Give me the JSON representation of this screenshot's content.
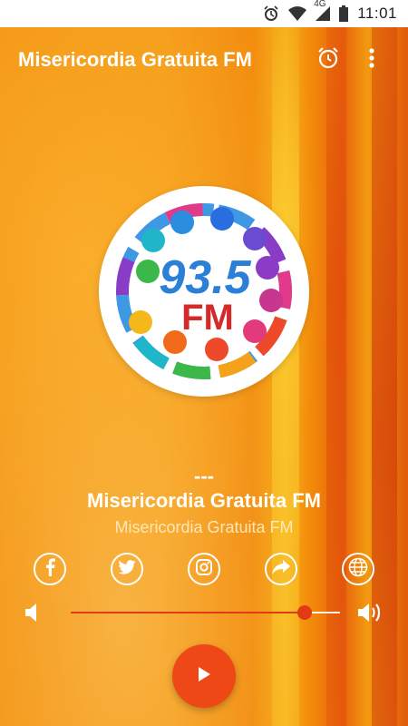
{
  "status_bar": {
    "time": "11:01",
    "network": "4G",
    "icons": [
      "alarm-icon",
      "wifi-icon",
      "signal-icon",
      "battery-icon"
    ]
  },
  "app_bar": {
    "title": "Misericordia Gratuita FM",
    "actions": [
      "alarm-clock-icon",
      "more-vert-icon"
    ]
  },
  "logo": {
    "frequency": "93.5",
    "band": "FM"
  },
  "now_playing": {
    "track": "---",
    "station": "Misericordia Gratuita FM",
    "subtitle": "Misericordia Gratuita FM"
  },
  "social_links": [
    "facebook-icon",
    "twitter-icon",
    "instagram-icon",
    "share-icon",
    "website-icon"
  ],
  "volume": {
    "level": 0.87
  },
  "player": {
    "state_icon": "play-icon"
  },
  "colors": {
    "accent": "#ee4816",
    "background": "#f08a0c",
    "text": "#ffffff"
  }
}
